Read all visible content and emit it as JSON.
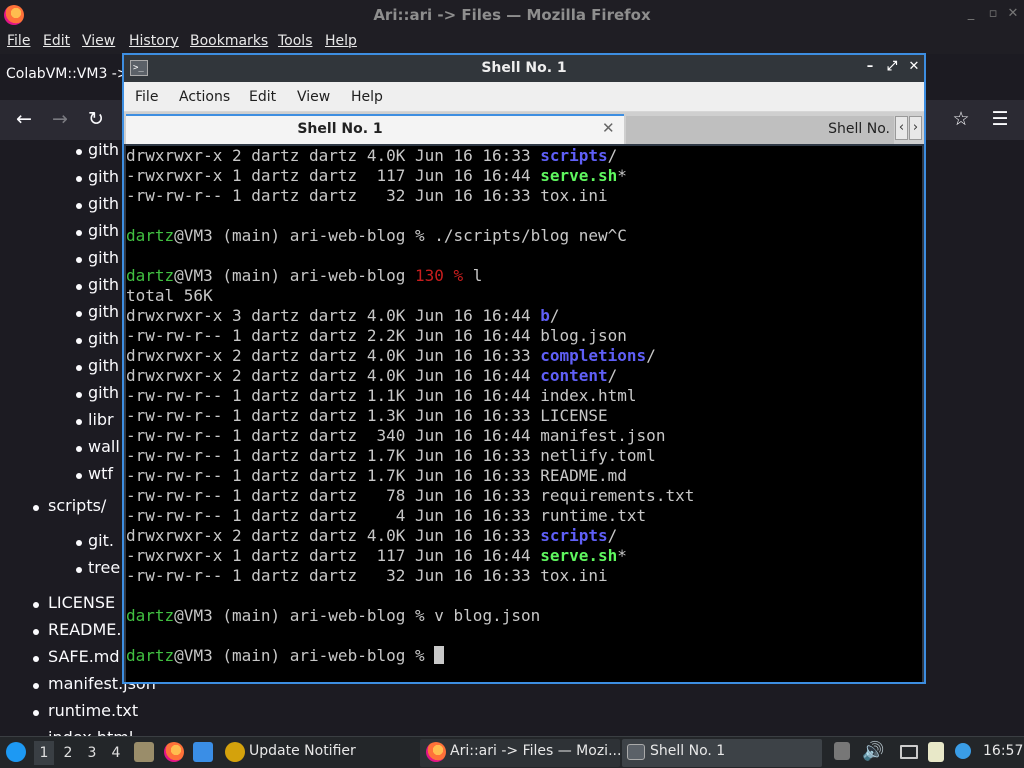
{
  "firefox": {
    "title": "Ari::ari -> Files — Mozilla Firefox",
    "menu": [
      "File",
      "Edit",
      "View",
      "History",
      "Bookmarks",
      "Tools",
      "Help"
    ],
    "tab_label": "ColabVM::VM3 ->",
    "nav_icons": [
      "back-icon",
      "forward-icon",
      "reload-icon",
      "star-icon",
      "hamburger-menu-icon"
    ],
    "page_items": {
      "nested_github": [
        "gith",
        "gith",
        "gith",
        "gith",
        "gith",
        "gith",
        "gith",
        "gith",
        "gith",
        "gith"
      ],
      "nested_other": [
        "libr",
        "wall",
        "wtf"
      ],
      "scripts": "scripts/",
      "scripts_children": [
        "git.",
        "tree"
      ],
      "files": [
        "LICENSE",
        "README.m",
        "SAFE.md",
        "manifest.json",
        "runtime.txt",
        "index.html"
      ]
    }
  },
  "shell": {
    "title": "Shell No. 1",
    "menu": [
      "File",
      "Actions",
      "Edit",
      "View",
      "Help"
    ],
    "tabs": [
      {
        "label": "Shell No. 1",
        "active": true
      },
      {
        "label": "Shell No.",
        "active": false
      }
    ],
    "terminal": {
      "lines": [
        {
          "t": "ls",
          "perm": "drwxrwxr-x 2 dartz dartz 4.0K Jun 16 16:33 ",
          "name": "scripts",
          "suffix": "/",
          "kind": "dir"
        },
        {
          "t": "ls",
          "perm": "-rwxrwxr-x 1 dartz dartz  117 Jun 16 16:44 ",
          "name": "serve.sh",
          "suffix": "*",
          "kind": "exe"
        },
        {
          "t": "ls",
          "perm": "-rw-rw-r-- 1 dartz dartz   32 Jun 16 16:33 ",
          "name": "tox.ini",
          "suffix": "",
          "kind": "file"
        },
        {
          "t": "blank"
        },
        {
          "t": "prompt",
          "user": "dartz",
          "host": "@VM3 (main) ari-web-blog ",
          "status": "",
          "sym": "%",
          "cmd": " ./scripts/blog new^C"
        },
        {
          "t": "blank"
        },
        {
          "t": "prompt",
          "user": "dartz",
          "host": "@VM3 (main) ari-web-blog ",
          "status": "130 ",
          "sym": "%",
          "cmd": " l"
        },
        {
          "t": "text",
          "text": "total 56K"
        },
        {
          "t": "ls",
          "perm": "drwxrwxr-x 3 dartz dartz 4.0K Jun 16 16:44 ",
          "name": "b",
          "suffix": "/",
          "kind": "dir"
        },
        {
          "t": "ls",
          "perm": "-rw-rw-r-- 1 dartz dartz 2.2K Jun 16 16:44 ",
          "name": "blog.json",
          "suffix": "",
          "kind": "file"
        },
        {
          "t": "ls",
          "perm": "drwxrwxr-x 2 dartz dartz 4.0K Jun 16 16:33 ",
          "name": "completions",
          "suffix": "/",
          "kind": "dir"
        },
        {
          "t": "ls",
          "perm": "drwxrwxr-x 2 dartz dartz 4.0K Jun 16 16:44 ",
          "name": "content",
          "suffix": "/",
          "kind": "dir"
        },
        {
          "t": "ls",
          "perm": "-rw-rw-r-- 1 dartz dartz 1.1K Jun 16 16:44 ",
          "name": "index.html",
          "suffix": "",
          "kind": "file"
        },
        {
          "t": "ls",
          "perm": "-rw-rw-r-- 1 dartz dartz 1.3K Jun 16 16:33 ",
          "name": "LICENSE",
          "suffix": "",
          "kind": "file"
        },
        {
          "t": "ls",
          "perm": "-rw-rw-r-- 1 dartz dartz  340 Jun 16 16:44 ",
          "name": "manifest.json",
          "suffix": "",
          "kind": "file"
        },
        {
          "t": "ls",
          "perm": "-rw-rw-r-- 1 dartz dartz 1.7K Jun 16 16:33 ",
          "name": "netlify.toml",
          "suffix": "",
          "kind": "file"
        },
        {
          "t": "ls",
          "perm": "-rw-rw-r-- 1 dartz dartz 1.7K Jun 16 16:33 ",
          "name": "README.md",
          "suffix": "",
          "kind": "file"
        },
        {
          "t": "ls",
          "perm": "-rw-rw-r-- 1 dartz dartz   78 Jun 16 16:33 ",
          "name": "requirements.txt",
          "suffix": "",
          "kind": "file"
        },
        {
          "t": "ls",
          "perm": "-rw-rw-r-- 1 dartz dartz    4 Jun 16 16:33 ",
          "name": "runtime.txt",
          "suffix": "",
          "kind": "file"
        },
        {
          "t": "ls",
          "perm": "drwxrwxr-x 2 dartz dartz 4.0K Jun 16 16:33 ",
          "name": "scripts",
          "suffix": "/",
          "kind": "dir"
        },
        {
          "t": "ls",
          "perm": "-rwxrwxr-x 1 dartz dartz  117 Jun 16 16:44 ",
          "name": "serve.sh",
          "suffix": "*",
          "kind": "exe"
        },
        {
          "t": "ls",
          "perm": "-rw-rw-r-- 1 dartz dartz   32 Jun 16 16:33 ",
          "name": "tox.ini",
          "suffix": "",
          "kind": "file"
        },
        {
          "t": "blank"
        },
        {
          "t": "prompt",
          "user": "dartz",
          "host": "@VM3 (main) ari-web-blog ",
          "status": "",
          "sym": "%",
          "cmd": " v blog.json"
        },
        {
          "t": "blank"
        },
        {
          "t": "prompt",
          "user": "dartz",
          "host": "@VM3 (main) ari-web-blog ",
          "status": "",
          "sym": "%",
          "cmd": " ",
          "cursor": true
        }
      ]
    }
  },
  "taskbar": {
    "workspaces": [
      "1",
      "2",
      "3",
      "4"
    ],
    "update_notifier": "Update Notifier",
    "tasks": [
      "Ari::ari -> Files — Mozi...",
      "Shell No. 1"
    ],
    "clock": "16:57"
  },
  "colors": {
    "accent": "#3d8ee1",
    "prompt_green": "#41c041",
    "dir_blue": "#5f5ff7",
    "exe_green": "#5ff75f",
    "status_red": "#c81e1e"
  }
}
